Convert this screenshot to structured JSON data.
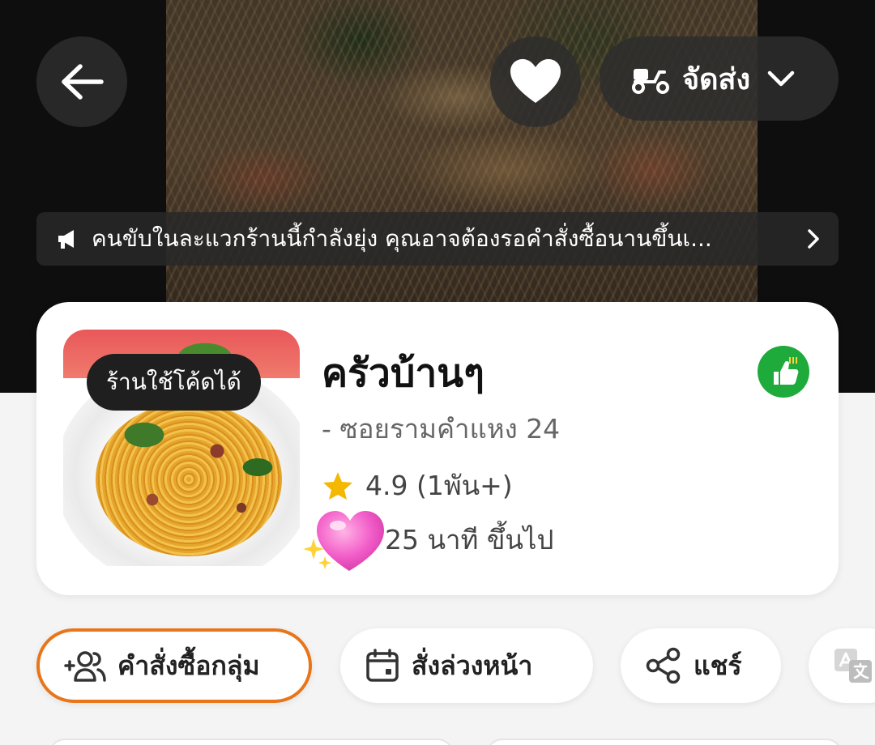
{
  "header": {
    "delivery_mode": "จัดส่ง",
    "notice": "คนขับในละแวกร้านนี้กำลังยุ่ง คุณอาจต้องรอคำสั่งซื้อนานขึ้นเ..."
  },
  "shop": {
    "coupon_badge": "ร้านใช้โค้ดได้",
    "name": "ครัวบ้านๆ",
    "branch": "- ซอยรามคำแหง 24",
    "rating": "4.9 (1พัน+)",
    "eta": "25 นาที ขึ้นไป"
  },
  "actions": {
    "group_order": "คำสั่งซื้อกลุ่ม",
    "preorder": "สั่งล่วงหน้า",
    "share": "แชร์"
  },
  "colors": {
    "accent": "#e8751a",
    "verified": "#1faa3c",
    "star": "#f5b800"
  }
}
